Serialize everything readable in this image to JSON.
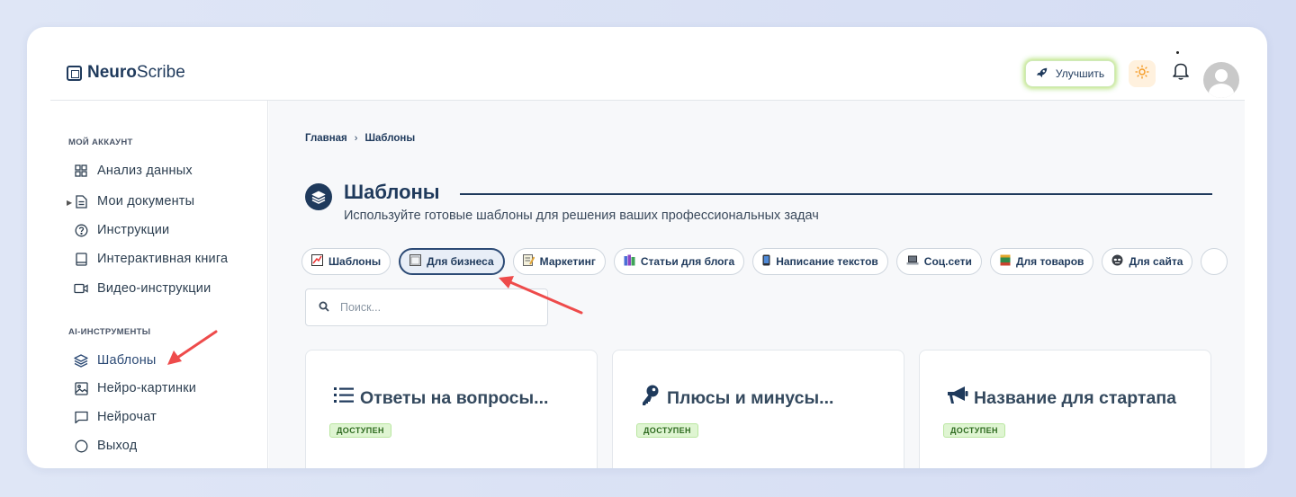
{
  "app": {
    "brand_bold": "Neuro",
    "brand_light": "Scribe"
  },
  "header": {
    "upgrade_label": "Улучшить"
  },
  "sidebar": {
    "section_account": "МОЙ АККАУНТ",
    "account_items": [
      "Анализ данных",
      "Мои документы",
      "Инструкции",
      "Интерактивная книга",
      "Видео-инструкции"
    ],
    "section_tools": "AI-ИНСТРУМЕНТЫ",
    "tool_items": [
      "Шаблоны",
      "Нейро-картинки",
      "Нейрочат",
      "Выход"
    ]
  },
  "breadcrumb": {
    "home": "Главная",
    "separator": "›",
    "current": "Шаблоны"
  },
  "page": {
    "title": "Шаблоны",
    "subtitle": "Используйте готовые шаблоны для решения ваших профессиональных задач"
  },
  "chips": [
    {
      "label": "Шаблоны",
      "icon": "chart-check-icon",
      "active": false
    },
    {
      "label": "Для бизнеса",
      "icon": "window-icon",
      "active": true
    },
    {
      "label": "Маркетинг",
      "icon": "memo-icon",
      "active": false
    },
    {
      "label": "Статьи для блога",
      "icon": "books-icon",
      "active": false
    },
    {
      "label": "Написание текстов",
      "icon": "phone-icon",
      "active": false
    },
    {
      "label": "Соц.сети",
      "icon": "laptop-icon",
      "active": false
    },
    {
      "label": "Для товаров",
      "icon": "ledger-icon",
      "active": false
    },
    {
      "label": "Для сайта",
      "icon": "mask-icon",
      "active": false
    }
  ],
  "search": {
    "placeholder": "Поиск..."
  },
  "cards": [
    {
      "title": "Ответы на вопросы...",
      "badge": "ДОСТУПЕН",
      "icon": "list-icon"
    },
    {
      "title": "Плюсы и минусы...",
      "badge": "ДОСТУПЕН",
      "icon": "key-icon"
    },
    {
      "title": "Название для стартапа",
      "badge": "ДОСТУПЕН",
      "icon": "megaphone-icon"
    }
  ],
  "colors": {
    "primary": "#1f3a5c",
    "accent_arrow": "#ee4b4b",
    "badge_bg": "#dff5d2",
    "badge_text": "#2d6a1f",
    "sun": "#f59a23"
  }
}
